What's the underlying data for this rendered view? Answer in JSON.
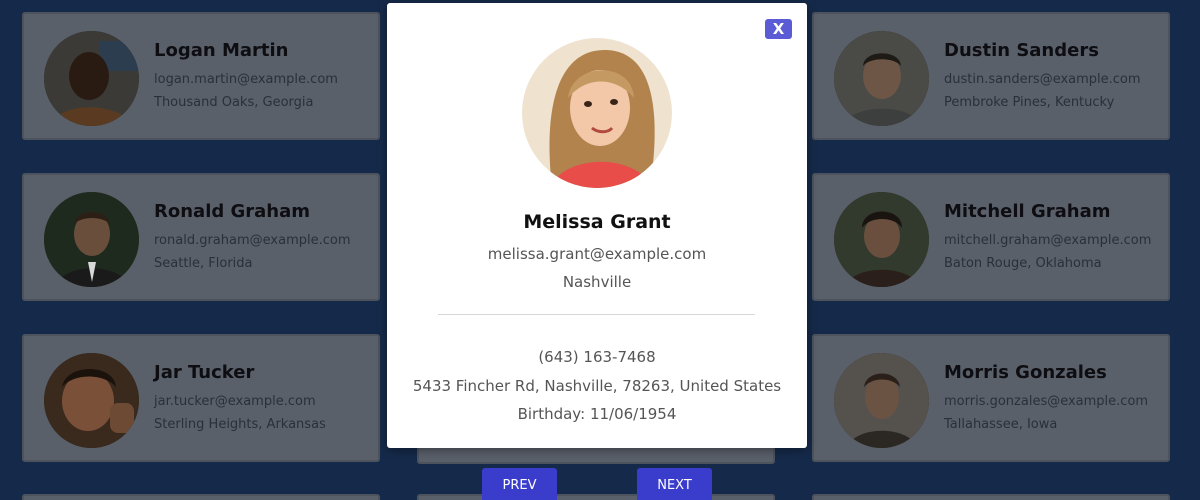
{
  "cards": [
    {
      "name": "Logan Martin",
      "email": "logan.martin@example.com",
      "city": "Thousand Oaks, Georgia"
    },
    {
      "name": "Dustin Sanders",
      "email": "dustin.sanders@example.com",
      "city": "Pembroke Pines, Kentucky"
    },
    {
      "name": "Ronald Graham",
      "email": "ronald.graham@example.com",
      "city": "Seattle, Florida"
    },
    {
      "name": "Mitchell Graham",
      "email": "mitchell.graham@example.com",
      "city": "Baton Rouge, Oklahoma"
    },
    {
      "name": "Jar Tucker",
      "email": "jar.tucker@example.com",
      "city": "Sterling Heights, Arkansas"
    },
    {
      "name": "Morris Gonzales",
      "email": "morris.gonzales@example.com",
      "city": "Tallahassee, Iowa"
    }
  ],
  "pagination": {
    "prev_label": "PREV",
    "next_label": "NEXT"
  },
  "modal": {
    "close_label": "X",
    "name": "Melissa Grant",
    "email": "melissa.grant@example.com",
    "city": "Nashville",
    "phone": "(643) 163-7468",
    "address": "5433 Fincher Rd, Nashville, 78263, United States",
    "birthday_label": "Birthday:",
    "birthday": "11/06/1954"
  },
  "colors": {
    "backdrop": "#152a4a",
    "card_overlay": "#5a606a",
    "button": "#3a3ccc",
    "close_button": "#5b5bd6"
  }
}
